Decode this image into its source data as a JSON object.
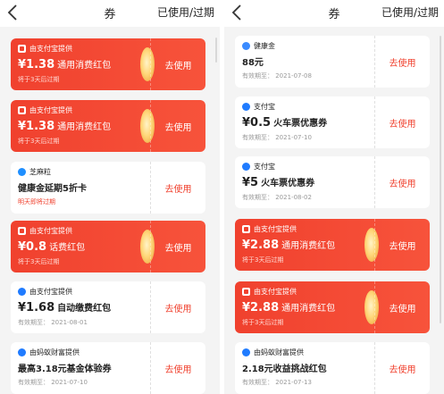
{
  "colors": {
    "accent": "#f0412e",
    "card_red": "#f7533b",
    "bg": "#f4f4f4"
  },
  "header": {
    "title": "券",
    "filter": "已使用/过期",
    "back_icon": "chevron-left-icon"
  },
  "left": [
    {
      "style": "red",
      "issuer": "由支付宝提供",
      "amount": "¥1.38",
      "name": "通用消费红包",
      "expiry": "将于3天后过期",
      "cta": "去使用"
    },
    {
      "style": "red",
      "issuer": "由支付宝提供",
      "amount": "¥1.38",
      "name": "通用消费红包",
      "expiry": "将于3天后过期",
      "cta": "去使用"
    },
    {
      "style": "white",
      "issuer": "芝麻粒",
      "title": "健康金延期5折卡",
      "expiry": "明天即将过期",
      "expiry_warn": true,
      "cta": "去使用"
    },
    {
      "style": "red",
      "issuer": "由支付宝提供",
      "amount": "¥0.8",
      "name": "话费红包",
      "expiry": "将于3天后过期",
      "cta": "去使用"
    },
    {
      "style": "white",
      "issuer": "由支付宝提供",
      "amount": "¥1.68",
      "name": "自动缴费红包",
      "expiry": "有效期至： 2021-08-01",
      "cta": "去使用"
    },
    {
      "style": "white",
      "issuer": "由蚂蚁财富提供",
      "title": "最高3.18元基金体验券",
      "expiry": "有效期至： 2021-07-10",
      "cta": "去使用"
    }
  ],
  "right": [
    {
      "style": "white",
      "issuer": "健康金",
      "title": "88元",
      "expiry": "有效期至： 2021-07-08",
      "cta": "去使用"
    },
    {
      "style": "white",
      "issuer": "支付宝",
      "amount": "¥0.5",
      "name": "火车票优惠券",
      "expiry": "有效期至： 2021-07-10",
      "cta": "去使用"
    },
    {
      "style": "white",
      "issuer": "支付宝",
      "amount": "¥5",
      "name": "火车票优惠券",
      "expiry": "有效期至： 2021-08-02",
      "cta": "去使用"
    },
    {
      "style": "red",
      "issuer": "由支付宝提供",
      "amount": "¥2.88",
      "name": "通用消费红包",
      "expiry": "将于3天后过期",
      "cta": "去使用"
    },
    {
      "style": "red",
      "issuer": "由支付宝提供",
      "amount": "¥2.88",
      "name": "通用消费红包",
      "expiry": "将于3天后过期",
      "cta": "去使用"
    },
    {
      "style": "white",
      "issuer": "由蚂蚁财富提供",
      "title": "2.18元收益挑战红包",
      "expiry": "有效期至： 2021-07-13",
      "cta": "去使用"
    }
  ]
}
